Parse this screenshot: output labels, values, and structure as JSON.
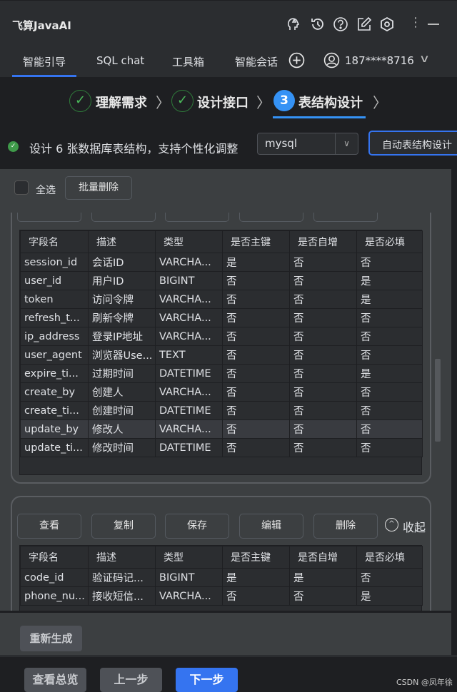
{
  "app": {
    "title": "飞算JavaAI"
  },
  "nav": {
    "tabs": [
      "智能引导",
      "SQL chat",
      "工具箱",
      "智能会话"
    ],
    "user": "187****8716"
  },
  "steps": [
    {
      "label": "理解需求",
      "state": "done"
    },
    {
      "label": "设计接口",
      "state": "done"
    },
    {
      "label": "表结构设计",
      "state": "active",
      "number": "3"
    }
  ],
  "status": {
    "text": "设计 6 张数据库表结构，支持个性化调整",
    "db": "mysql",
    "auto_button": "自动表结构设计"
  },
  "toolbar": {
    "select_all": "全选",
    "batch_delete": "批量删除"
  },
  "columns": [
    "字段名",
    "描述",
    "类型",
    "是否主键",
    "是否自增",
    "是否必填"
  ],
  "table1": [
    [
      "session_id",
      "会话ID",
      "VARCHA...",
      "是",
      "否",
      "否"
    ],
    [
      "user_id",
      "用户ID",
      "BIGINT",
      "否",
      "否",
      "是"
    ],
    [
      "token",
      "访问令牌",
      "VARCHA...",
      "否",
      "否",
      "是"
    ],
    [
      "refresh_t...",
      "刷新令牌",
      "VARCHA...",
      "否",
      "否",
      "否"
    ],
    [
      "ip_address",
      "登录IP地址",
      "VARCHA...",
      "否",
      "否",
      "否"
    ],
    [
      "user_agent",
      "浏览器Use...",
      "TEXT",
      "否",
      "否",
      "否"
    ],
    [
      "expire_ti...",
      "过期时间",
      "DATETIME",
      "否",
      "否",
      "是"
    ],
    [
      "create_by",
      "创建人",
      "VARCHA...",
      "否",
      "否",
      "否"
    ],
    [
      "create_ti...",
      "创建时间",
      "DATETIME",
      "否",
      "否",
      "否"
    ],
    [
      "update_by",
      "修改人",
      "VARCHA...",
      "否",
      "否",
      "否"
    ],
    [
      "update_ti...",
      "修改时间",
      "DATETIME",
      "否",
      "否",
      "否"
    ]
  ],
  "card_actions": [
    "查看",
    "复制",
    "保存",
    "编辑",
    "删除"
  ],
  "collapse": "收起",
  "table2": [
    [
      "code_id",
      "验证码记...",
      "BIGINT",
      "是",
      "是",
      "否"
    ],
    [
      "phone_nu...",
      "接收短信...",
      "VARCHA...",
      "否",
      "否",
      "是"
    ]
  ],
  "regenerate": "重新生成",
  "footer": {
    "overview": "查看总览",
    "prev": "上一步",
    "next": "下一步"
  },
  "watermark": "CSDN @凤年徐",
  "colors": {
    "accent": "#3574f0",
    "success": "#4cbb5c"
  }
}
